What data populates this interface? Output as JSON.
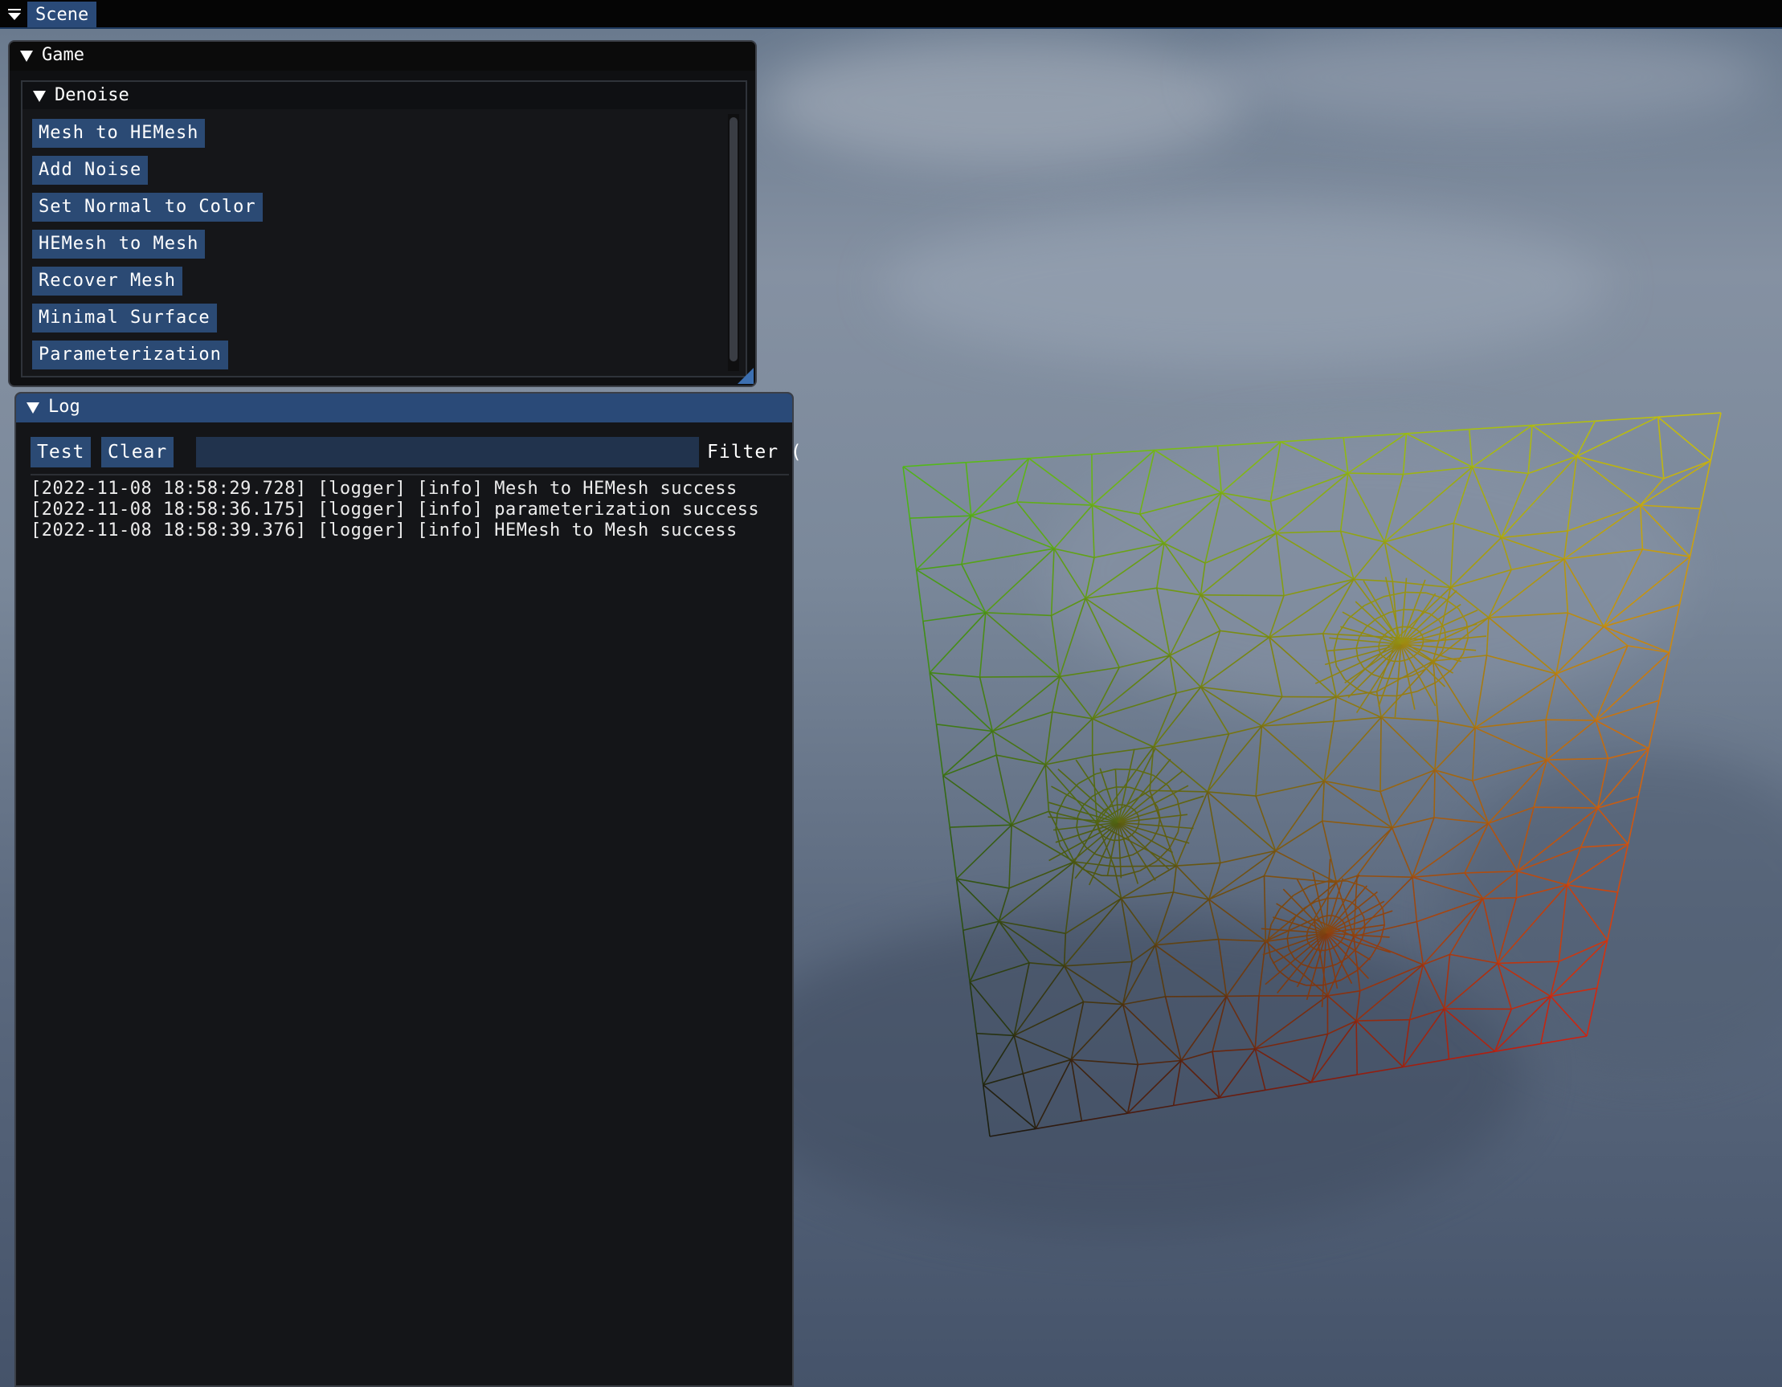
{
  "tabbar": {
    "scene_tab": "Scene"
  },
  "game_window": {
    "title": "Game",
    "denoise": {
      "title": "Denoise",
      "buttons": [
        "Mesh to HEMesh",
        "Add Noise",
        "Set Normal to Color",
        "HEMesh to Mesh",
        "Recover Mesh",
        "Minimal Surface",
        "Parameterization"
      ]
    }
  },
  "log_window": {
    "title": "Log",
    "test_label": "Test",
    "clear_label": "Clear",
    "filter_value": "",
    "filter_label": "Filter (",
    "lines": [
      "[2022-11-08 18:58:29.728] [logger] [info] Mesh to HEMesh success",
      "[2022-11-08 18:58:36.175] [logger] [info] parameterization success",
      "[2022-11-08 18:58:39.376] [logger] [info] HEMesh to Mesh success"
    ]
  },
  "scene": {
    "mesh_color_top_left": "#4fb81a",
    "mesh_color_top_right": "#c8c010",
    "mesh_color_bottom_left": "#1a1a10",
    "mesh_color_bottom_right": "#d42010",
    "mesh_color_center": "#a8b020"
  }
}
